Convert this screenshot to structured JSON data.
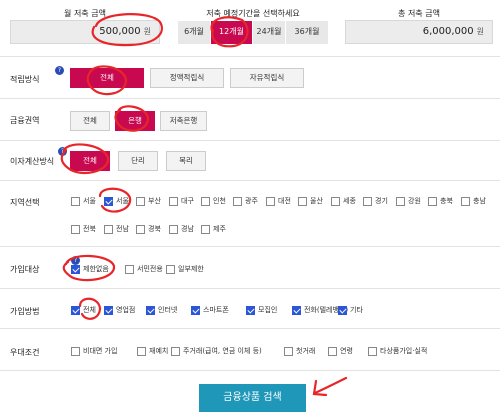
{
  "header": {
    "monthly_label": "월 저축 금액",
    "monthly_value": "500,000",
    "monthly_unit": "원",
    "period_label": "저축 예정기간을 선택하세요",
    "period_options": [
      "6개월",
      "12개월",
      "24개월",
      "36개월"
    ],
    "period_selected": "12개월",
    "total_label": "총 저축 금액",
    "total_value": "6,000,000",
    "total_unit": "원"
  },
  "method": {
    "label": "적립방식",
    "options": [
      "전체",
      "정액적립식",
      "자유적립식"
    ],
    "selected": "전체"
  },
  "sector": {
    "label": "금융권역",
    "options": [
      "전체",
      "은행",
      "저축은행"
    ],
    "selected": "은행"
  },
  "interest": {
    "label": "이자계산방식",
    "options": [
      "전체",
      "단리",
      "복리"
    ],
    "selected": "전체"
  },
  "region": {
    "label": "지역선택",
    "items": [
      {
        "label": "서울",
        "checked": false
      },
      {
        "label": "서울",
        "checked": true
      },
      {
        "label": "부산",
        "checked": false
      },
      {
        "label": "대구",
        "checked": false
      },
      {
        "label": "인천",
        "checked": false
      },
      {
        "label": "광주",
        "checked": false
      },
      {
        "label": "대전",
        "checked": false
      },
      {
        "label": "울산",
        "checked": false
      },
      {
        "label": "세종",
        "checked": false
      },
      {
        "label": "경기",
        "checked": false
      },
      {
        "label": "강원",
        "checked": false
      },
      {
        "label": "충북",
        "checked": false
      },
      {
        "label": "충남",
        "checked": false
      },
      {
        "label": "전북",
        "checked": false
      },
      {
        "label": "전남",
        "checked": false
      },
      {
        "label": "경북",
        "checked": false
      },
      {
        "label": "경남",
        "checked": false
      },
      {
        "label": "제주",
        "checked": false
      }
    ]
  },
  "target": {
    "label": "가입대상",
    "items": [
      {
        "label": "제한없음",
        "checked": true
      },
      {
        "label": "서민전용",
        "checked": false
      },
      {
        "label": "일부제한",
        "checked": false
      }
    ]
  },
  "channel": {
    "label": "가입방법",
    "items": [
      {
        "label": "전체",
        "checked": true
      },
      {
        "label": "영업점",
        "checked": true
      },
      {
        "label": "인터넷",
        "checked": true
      },
      {
        "label": "스마트폰",
        "checked": true
      },
      {
        "label": "모집인",
        "checked": true
      },
      {
        "label": "전화(텔레뱅킹)",
        "checked": true
      },
      {
        "label": "기타",
        "checked": true
      }
    ]
  },
  "preference": {
    "label": "우대조건",
    "items": [
      {
        "label": "비대면 가입",
        "checked": false
      },
      {
        "label": "재예치",
        "checked": false
      },
      {
        "label": "주거래(급여, 연금 이체 등)",
        "checked": false
      },
      {
        "label": "첫거래",
        "checked": false
      },
      {
        "label": "연령",
        "checked": false
      },
      {
        "label": "타상품가입·실적",
        "checked": false
      }
    ]
  },
  "search_button": "금융상품 검색",
  "colors": {
    "accent": "#c8084f",
    "check": "#2b57d6",
    "search": "#1e97b8",
    "annotation": "#e8262a"
  }
}
